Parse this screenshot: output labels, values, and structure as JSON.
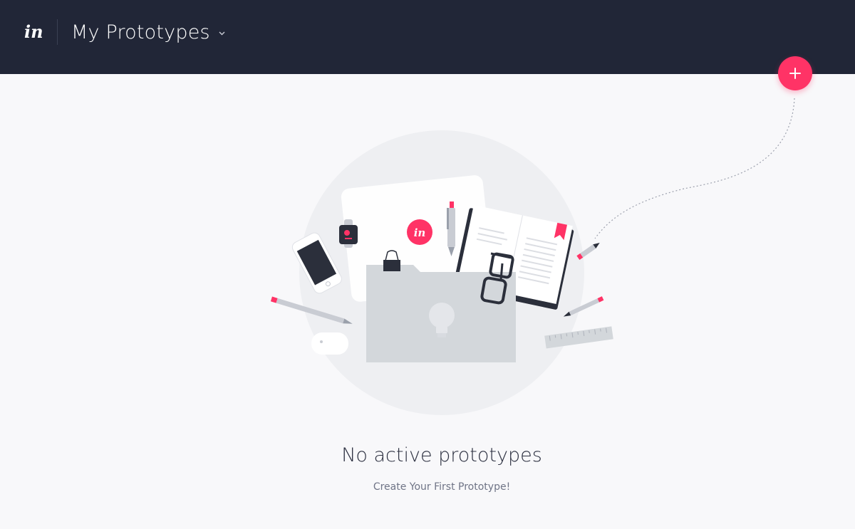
{
  "header": {
    "logo_text": "in",
    "title": "My Prototypes",
    "dropdown_icon": "chevron-down-icon"
  },
  "actions": {
    "add_icon": "plus-icon"
  },
  "empty_state": {
    "title": "No active prototypes",
    "subtitle": "Create Your First Prototype!",
    "badge_text": "in"
  },
  "colors": {
    "topbar": "#212637",
    "accent": "#ff3366",
    "background": "#f8f8fa",
    "circle": "#eeeff2"
  }
}
